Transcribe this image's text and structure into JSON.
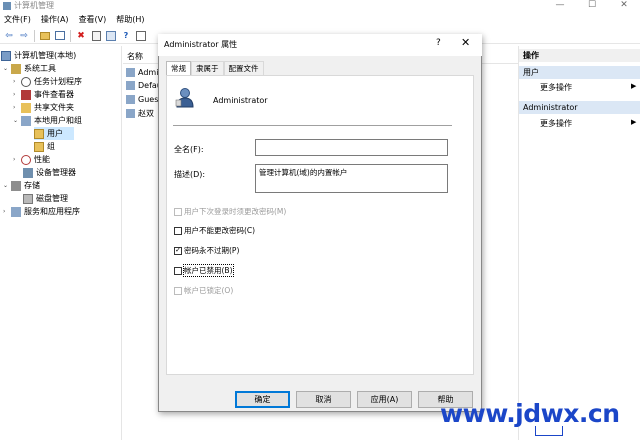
{
  "window": {
    "title": "计算机管理",
    "min": "—",
    "max": "☐",
    "close": "✕"
  },
  "menu": [
    "文件(F)",
    "操作(A)",
    "查看(V)",
    "帮助(H)"
  ],
  "tree": {
    "root": "计算机管理(本地)",
    "system_tools": "系统工具",
    "task_scheduler": "任务计划程序",
    "event_viewer": "事件查看器",
    "shared_folders": "共享文件夹",
    "local_users": "本地用户和组",
    "users": "用户",
    "groups": "组",
    "performance": "性能",
    "device_manager": "设备管理器",
    "storage": "存储",
    "disk_mgmt": "磁盘管理",
    "services": "服务和应用程序"
  },
  "list": {
    "col_name": "名称",
    "rows": [
      "Admin",
      "Defau",
      "Guest",
      "赵双"
    ]
  },
  "actions": {
    "header": "操作",
    "group1": "用户",
    "more1": "更多操作",
    "group2": "Administrator",
    "more2": "更多操作"
  },
  "dialog": {
    "title": "Administrator 属性",
    "help": "?",
    "close": "✕",
    "tabs": [
      "常规",
      "隶属于",
      "配置文件"
    ],
    "username": "Administrator",
    "fullname_label": "全名(F):",
    "fullname_value": "",
    "desc_label": "描述(D):",
    "desc_value": "管理计算机(域)的内置帐户",
    "checks": [
      {
        "label": "用户下次登录时须更改密码(M)",
        "checked": false,
        "disabled": true
      },
      {
        "label": "用户不能更改密码(C)",
        "checked": false,
        "disabled": false
      },
      {
        "label": "密码永不过期(P)",
        "checked": true,
        "disabled": false
      },
      {
        "label": "帐户已禁用(B)",
        "checked": false,
        "disabled": false
      },
      {
        "label": "帐户已锁定(O)",
        "checked": false,
        "disabled": true
      }
    ],
    "buttons": {
      "ok": "确定",
      "cancel": "取消",
      "apply": "应用(A)",
      "help": "帮助"
    }
  },
  "watermark": "www.jdwx.cn"
}
